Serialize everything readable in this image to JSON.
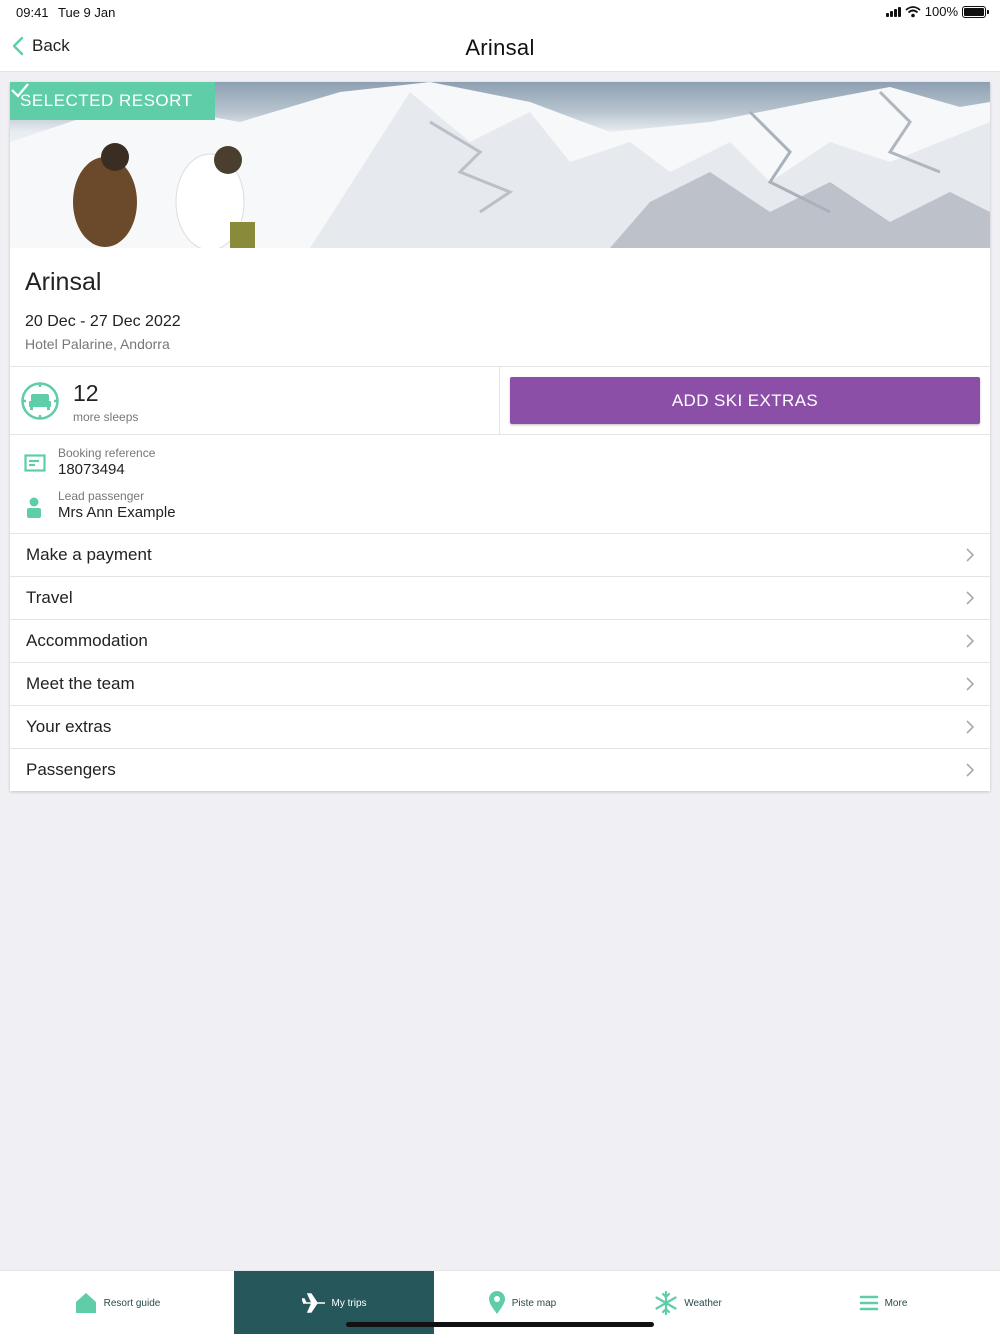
{
  "status_bar": {
    "time": "09:41",
    "date": "Tue 9 Jan",
    "battery": "100%"
  },
  "nav": {
    "back_label": "Back",
    "title": "Arinsal"
  },
  "resort": {
    "badge": "SELECTED RESORT",
    "name": "Arinsal",
    "dates": "20 Dec - 27 Dec 2022",
    "hotel": "Hotel Palarine, Andorra"
  },
  "countdown": {
    "number": "12",
    "label": "more sleeps"
  },
  "add_extras_label": "ADD SKI EXTRAS",
  "booking": {
    "reference_label": "Booking reference",
    "reference_value": "18073494",
    "lead_label": "Lead passenger",
    "lead_value": "Mrs Ann Example"
  },
  "menu": [
    {
      "label": "Make a payment"
    },
    {
      "label": "Travel"
    },
    {
      "label": "Accommodation"
    },
    {
      "label": "Meet the team"
    },
    {
      "label": "Your extras"
    },
    {
      "label": "Passengers"
    }
  ],
  "tabs": [
    {
      "label": "Resort guide",
      "icon": "house-icon"
    },
    {
      "label": "My trips",
      "icon": "plane-icon",
      "active": true
    },
    {
      "label": "Piste map",
      "icon": "map-pin-icon"
    },
    {
      "label": "Weather",
      "icon": "snowflake-icon"
    },
    {
      "label": "More",
      "icon": "hamburger-icon"
    }
  ],
  "colors": {
    "accent_green": "#5fcda8",
    "purple": "#8b4fa8",
    "dark_teal": "#26575a"
  }
}
